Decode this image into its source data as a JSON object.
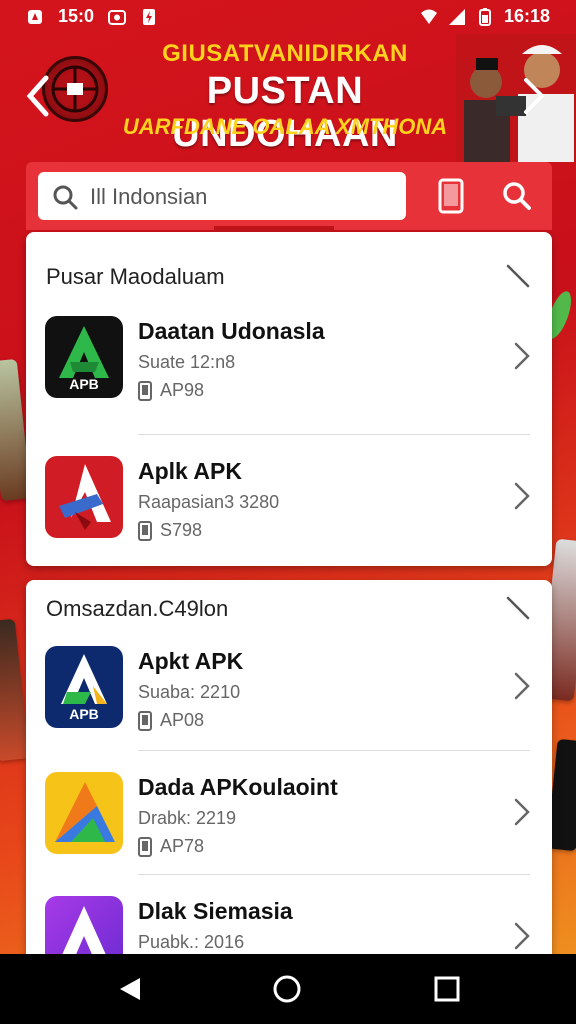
{
  "status_bar": {
    "time_left": "15:0",
    "time_right": "16:18"
  },
  "banner": {
    "line1": "GIUSATVANIDIRKAN",
    "line2": "PUSTAN UNDOHAAN",
    "line3": "UARFDANE OALAA XMTHONA"
  },
  "search": {
    "value": "Ill Indonsian",
    "placeholder": ""
  },
  "sections": [
    {
      "title": "Pusar Maodaluam",
      "items": [
        {
          "name": "Daatan Udonasla",
          "sub": "Suate 12:n8",
          "meta": "AP98",
          "icon_label": "APB",
          "icon": "green-a-icon"
        },
        {
          "name": "Aplk APK",
          "sub": "Raapasian3 3280",
          "meta": "S798",
          "icon_label": "",
          "icon": "red-a-icon"
        }
      ]
    },
    {
      "title": "Omsazdan.C49lon",
      "items": [
        {
          "name": "Apkt APK",
          "sub": "Suaba: 2210",
          "meta": "AP08",
          "icon_label": "APB",
          "icon": "blue-a-icon"
        },
        {
          "name": "Dada APKoulaoint",
          "sub": "Drabk: 2219",
          "meta": "AP78",
          "icon_label": "",
          "icon": "multicolor-a-icon"
        },
        {
          "name": "Dlak Siemasia",
          "sub": "Puabk.: 2016",
          "meta": "",
          "icon_label": "",
          "icon": "purple-a-icon"
        }
      ]
    }
  ],
  "colors": {
    "primary": "#e8323a",
    "dark_red": "#c0141a",
    "yellow": "#ffd21e"
  }
}
